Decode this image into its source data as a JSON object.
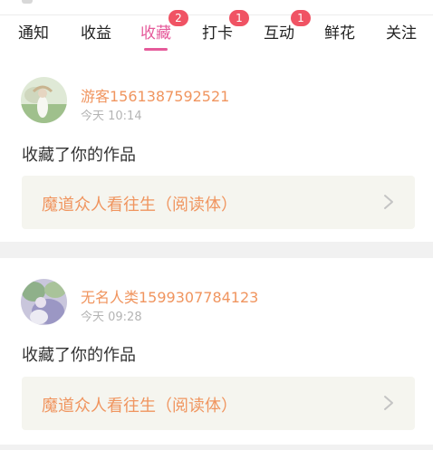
{
  "tabs": [
    {
      "label": "通知",
      "badge": null
    },
    {
      "label": "收益",
      "badge": null
    },
    {
      "label": "收藏",
      "badge": "2",
      "active": true
    },
    {
      "label": "打卡",
      "badge": "1"
    },
    {
      "label": "互动",
      "badge": "1"
    },
    {
      "label": "鲜花",
      "badge": null
    },
    {
      "label": "关注",
      "badge": null
    }
  ],
  "notifications": [
    {
      "username": "游客1561387592521",
      "time": "今天 10:14",
      "action": "收藏了你的作品",
      "work_title": "魔道众人看往生（阅读体）"
    },
    {
      "username": "无名人类1599307784123",
      "time": "今天 09:28",
      "action": "收藏了你的作品",
      "work_title": "魔道众人看往生（阅读体）"
    }
  ],
  "colors": {
    "accent_pink": "#e55a9a",
    "badge_red": "#f05364",
    "name_orange": "#f0955f",
    "card_bg": "#f5f5ef"
  },
  "icons": {
    "chevron": "chevron-right-icon"
  }
}
